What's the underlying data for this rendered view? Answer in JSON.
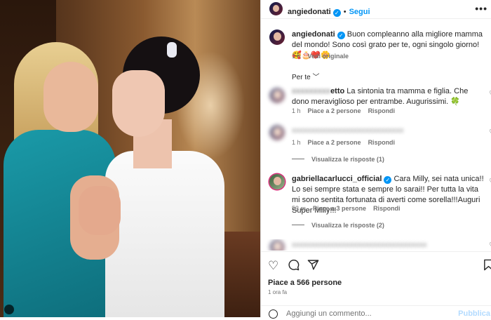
{
  "header": {
    "username": "angiedonati",
    "follow_label": "Segui",
    "more_label": "•••"
  },
  "caption": {
    "username": "angiedonati",
    "text": "Buon compleanno alla migliore mamma del mondo! Sono così grato per te, ogni singolo giorno! 🥰🎂❤️🌼",
    "time": "1 h",
    "translate_label": "Vedi originale"
  },
  "for_you_label": "Per te ﹀",
  "comments": [
    {
      "username_visible": "etto",
      "text": "La sintonia tra mamma e figlia. Che dono meraviglioso per entrambe. Augurissimi. 🍀",
      "time": "1 h",
      "likes": "Piace a 2 persone",
      "reply_label": "Rispondi"
    },
    {
      "time": "1 h",
      "likes": "Piace a 2 persone",
      "reply_label": "Rispondi",
      "replies_label": "Visualizza le risposte (1)"
    },
    {
      "username": "gabriellacarlucci_official",
      "text": "Cara Milly, sei nata unica!! Lo sei sempre stata e sempre lo sarai!! Per tutta la vita mi sono sentita fortunata di averti come sorella!!!Auguri Super Milly!!!",
      "time": "53 m",
      "likes": "Piace a 3 persone",
      "reply_label": "Rispondi",
      "replies_label": "Visualizza le risposte (2)"
    }
  ],
  "actions": {
    "like_icon": "heart-icon",
    "comment_icon": "comment-icon",
    "share_icon": "share-icon",
    "save_icon": "bookmark-icon"
  },
  "likes_text": "Piace a 566 persone",
  "posted_time": "1 ora fa",
  "comment_input": {
    "placeholder": "Aggiungi un commento...",
    "publish_label": "Pubblica"
  },
  "colors": {
    "accent": "#0095f6",
    "muted": "#737373",
    "text": "#262626"
  }
}
